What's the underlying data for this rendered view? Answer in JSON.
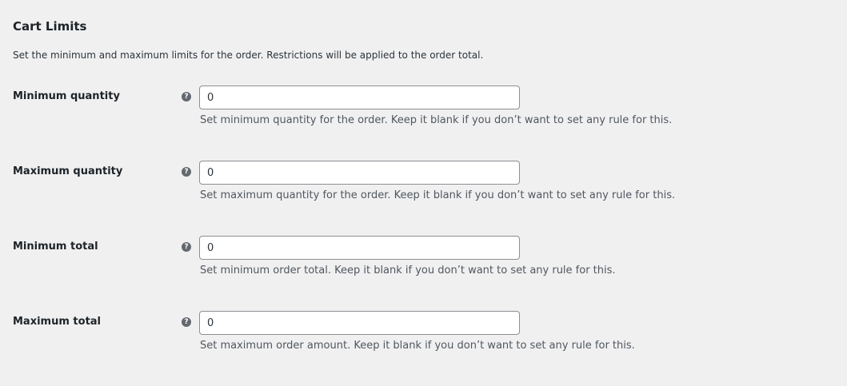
{
  "section": {
    "title": "Cart Limits",
    "description": "Set the minimum and maximum limits for the order. Restrictions will be applied to the order total."
  },
  "help_icon": "question-mark-circle-icon",
  "help_glyph": "?",
  "fields": [
    {
      "label": "Minimum quantity",
      "value": "0",
      "description": "Set minimum quantity for the order. Keep it blank if you don’t want to set any rule for this."
    },
    {
      "label": "Maximum quantity",
      "value": "0",
      "description": "Set maximum quantity for the order. Keep it blank if you don’t want to set any rule for this."
    },
    {
      "label": "Minimum total",
      "value": "0",
      "description": "Set minimum order total. Keep it blank if you don’t want to set any rule for this."
    },
    {
      "label": "Maximum total",
      "value": "0",
      "description": "Set maximum order amount. Keep it blank if you don’t want to set any rule for this."
    }
  ],
  "colors": {
    "background": "#f0f0f1",
    "input_border": "#8c8f94",
    "help_icon": "#646970",
    "description_text": "#50575e"
  }
}
